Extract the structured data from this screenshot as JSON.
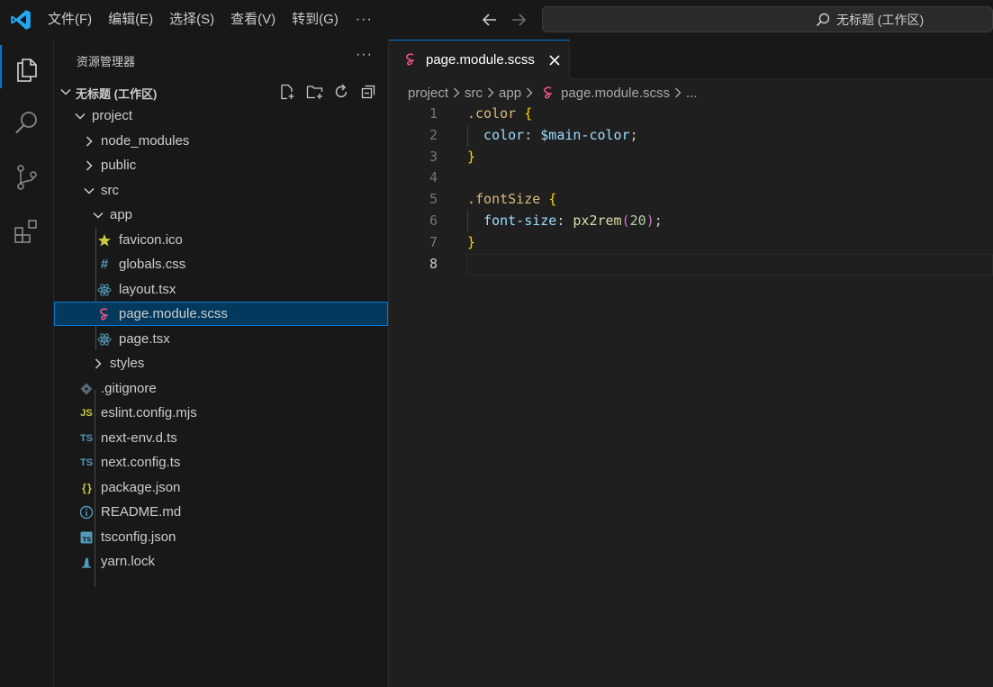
{
  "titlebar": {
    "menu": [
      "文件(F)",
      "编辑(E)",
      "选择(S)",
      "查看(V)",
      "转到(G)"
    ],
    "more": "···",
    "command_center": "无标题 (工作区)"
  },
  "sidebar": {
    "title": "资源管理器",
    "more": "···",
    "workspace": "无标题 (工作区)",
    "tree": [
      {
        "label": "project",
        "kind": "folder-open",
        "depth": 1
      },
      {
        "label": "node_modules",
        "kind": "folder",
        "depth": 2
      },
      {
        "label": "public",
        "kind": "folder",
        "depth": 2
      },
      {
        "label": "src",
        "kind": "folder-open",
        "depth": 2
      },
      {
        "label": "app",
        "kind": "folder-open",
        "depth": 3
      },
      {
        "label": "favicon.ico",
        "kind": "favicon-icon",
        "depth": 4
      },
      {
        "label": "globals.css",
        "kind": "css-icon",
        "depth": 4
      },
      {
        "label": "layout.tsx",
        "kind": "react-icon",
        "depth": 4
      },
      {
        "label": "page.module.scss",
        "kind": "sass-icon",
        "depth": 4,
        "selected": true
      },
      {
        "label": "page.tsx",
        "kind": "react-icon",
        "depth": 4
      },
      {
        "label": "styles",
        "kind": "folder",
        "depth": 3
      },
      {
        "label": ".gitignore",
        "kind": "git-icon",
        "depth": 2
      },
      {
        "label": "eslint.config.mjs",
        "kind": "js-icon",
        "depth": 2
      },
      {
        "label": "next-env.d.ts",
        "kind": "ts-icon",
        "depth": 2
      },
      {
        "label": "next.config.ts",
        "kind": "ts-icon",
        "depth": 2
      },
      {
        "label": "package.json",
        "kind": "json-icon",
        "depth": 2
      },
      {
        "label": "README.md",
        "kind": "info-icon",
        "depth": 2
      },
      {
        "label": "tsconfig.json",
        "kind": "tsconfig-icon",
        "depth": 2
      },
      {
        "label": "yarn.lock",
        "kind": "yarn-icon",
        "depth": 2
      }
    ],
    "icon_glyphs": {
      "js": "JS",
      "ts": "TS",
      "json": "{ }",
      "css": "#"
    }
  },
  "editor": {
    "tab_label": "page.module.scss",
    "breadcrumb": [
      "project",
      "src",
      "app",
      "page.module.scss",
      "..."
    ],
    "current_line": 8,
    "lines": [
      {
        "n": "1",
        "tokens": [
          {
            "t": ".color",
            "c": "t-sel"
          },
          {
            "t": " ",
            "c": "t-punc"
          },
          {
            "t": "{",
            "c": "t-brace"
          }
        ]
      },
      {
        "n": "2",
        "tokens": [
          {
            "t": "  color",
            "c": "t-prop"
          },
          {
            "t": ": ",
            "c": "t-punc"
          },
          {
            "t": "$main-color",
            "c": "t-prop"
          },
          {
            "t": ";",
            "c": "t-punc"
          }
        ]
      },
      {
        "n": "3",
        "tokens": [
          {
            "t": "}",
            "c": "t-brace"
          }
        ]
      },
      {
        "n": "4",
        "tokens": []
      },
      {
        "n": "5",
        "tokens": [
          {
            "t": ".fontSize",
            "c": "t-sel"
          },
          {
            "t": " ",
            "c": "t-punc"
          },
          {
            "t": "{",
            "c": "t-brace"
          }
        ]
      },
      {
        "n": "6",
        "tokens": [
          {
            "t": "  font-size",
            "c": "t-prop"
          },
          {
            "t": ": ",
            "c": "t-punc"
          },
          {
            "t": "px2rem",
            "c": "t-func"
          },
          {
            "t": "(",
            "c": "t-paren"
          },
          {
            "t": "20",
            "c": "t-num"
          },
          {
            "t": ")",
            "c": "t-paren"
          },
          {
            "t": ";",
            "c": "t-punc"
          }
        ]
      },
      {
        "n": "7",
        "tokens": [
          {
            "t": "}",
            "c": "t-brace"
          }
        ]
      },
      {
        "n": "8",
        "tokens": []
      }
    ]
  },
  "colors": {
    "accent": "#0078d4",
    "selection_bg": "#04395e",
    "sass": "#f55385",
    "react": "#519aba",
    "ts": "#519aba",
    "js": "#cbcb41",
    "json": "#cbcb41",
    "favicon": "#cbcb41",
    "git": "#41535b"
  }
}
